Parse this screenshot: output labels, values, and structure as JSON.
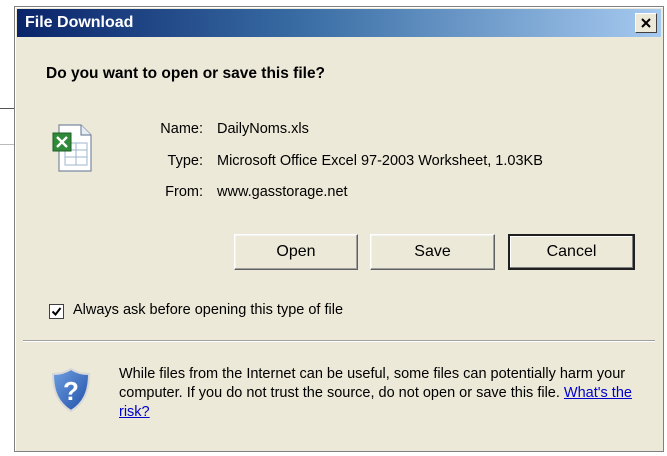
{
  "dialog": {
    "title": "File Download",
    "question": "Do you want to open or save this file?",
    "close_glyph": "×"
  },
  "file": {
    "icon": "excel-file-icon",
    "labels": {
      "name": "Name:",
      "type": "Type:",
      "from": "From:"
    },
    "name": "DailyNoms.xls",
    "type": "Microsoft Office Excel 97-2003 Worksheet, 1.03KB",
    "from": "www.gasstorage.net"
  },
  "buttons": {
    "open": "Open",
    "save": "Save",
    "cancel": "Cancel"
  },
  "checkbox": {
    "checked": true,
    "label": "Always ask before opening this type of file"
  },
  "warning": {
    "icon": "shield-question-icon",
    "text": "While files from the Internet can be useful, some files can potentially harm your computer. If you do not trust the source, do not open or save this file.",
    "link": "What's the risk?"
  },
  "colors": {
    "title_start": "#0a246a",
    "title_end": "#a6caf0",
    "dialog_bg": "#ece9d8",
    "link": "#0000cc"
  }
}
